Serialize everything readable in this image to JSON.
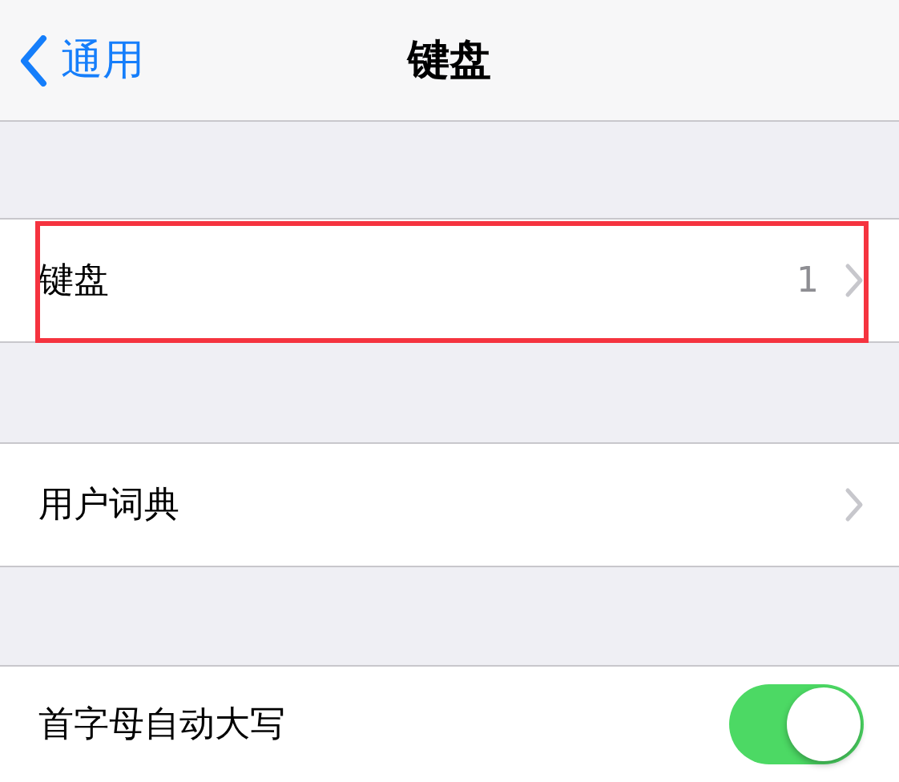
{
  "nav": {
    "back_label": "通用",
    "title": "键盘"
  },
  "sections": [
    {
      "rows": [
        {
          "kind": "link",
          "label": "键盘",
          "value": "1",
          "highlighted": true
        }
      ]
    },
    {
      "rows": [
        {
          "kind": "link",
          "label": "用户词典",
          "highlighted": false
        }
      ]
    },
    {
      "rows": [
        {
          "kind": "toggle",
          "label": "首字母自动大写",
          "on": true
        }
      ]
    }
  ]
}
